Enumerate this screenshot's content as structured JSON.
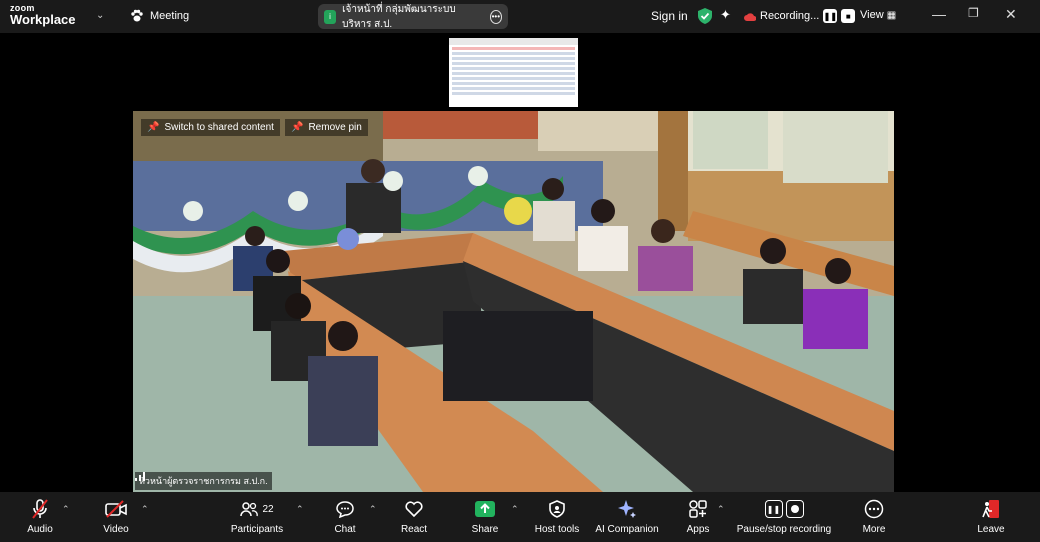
{
  "app": {
    "brand_top": "zoom",
    "brand_bottom": "Workplace"
  },
  "topbar": {
    "meeting_label": "Meeting",
    "meeting_name": "เจ้าหน้าที่ กลุ่มพัฒนาระบบบริหาร ส.ป.",
    "meeting_badge": "i",
    "sign_in": "Sign in",
    "recording_label": "Recording...",
    "view_label": "View"
  },
  "video": {
    "switch_label": "Switch to shared content",
    "remove_pin_label": "Remove pin",
    "speaker_name": "หัวหน้าผู้ตรวจราชการกรม ส.ป.ก."
  },
  "toolbar": {
    "audio": "Audio",
    "video": "Video",
    "participants": "Participants",
    "participants_count": "22",
    "chat": "Chat",
    "react": "React",
    "share": "Share",
    "host_tools": "Host tools",
    "ai_companion": "AI Companion",
    "apps": "Apps",
    "pause_stop": "Pause/stop recording",
    "more": "More",
    "leave": "Leave"
  },
  "colors": {
    "share_green": "#22b35e",
    "shield_green": "#2db36b",
    "leave_red": "#e02828"
  }
}
